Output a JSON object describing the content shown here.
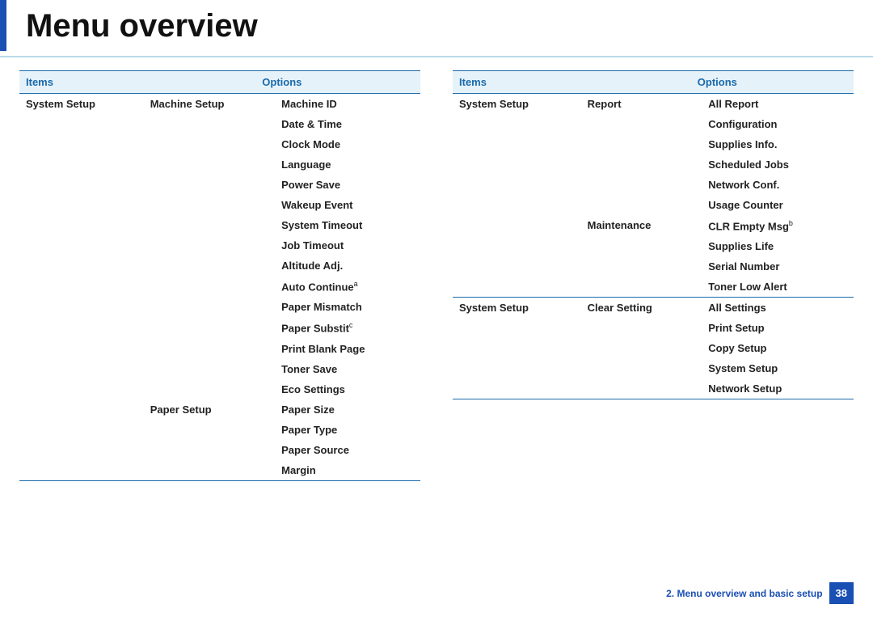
{
  "title": "Menu overview",
  "headers": {
    "items": "Items",
    "options": "Options"
  },
  "left": [
    {
      "item": "System Setup",
      "sub": "Machine Setup",
      "opts": [
        "Machine ID",
        "Date & Time",
        "Clock Mode",
        "Language",
        "Power Save",
        "Wakeup Event",
        "System Timeout",
        "Job Timeout",
        "Altitude Adj.",
        "Auto Continue",
        "Paper Mismatch",
        "Paper Substit",
        " Print Blank Page",
        "Toner Save",
        "Eco Settings"
      ]
    },
    {
      "item": "",
      "sub": "Paper Setup",
      "opts": [
        "Paper Size",
        "Paper Type",
        "Paper Source",
        "Margin"
      ]
    }
  ],
  "left_footnotes": {
    "Auto Continue": "a",
    "Paper Substit": "c"
  },
  "right": [
    {
      "item": "System Setup",
      "sub": "Report",
      "opts": [
        "All Report",
        "Configuration",
        "Supplies Info.",
        "Scheduled Jobs",
        "Network Conf.",
        "Usage Counter"
      ]
    },
    {
      "item": "",
      "sub": "Maintenance",
      "opts": [
        "CLR Empty Msg",
        "Supplies Life",
        "Serial Number",
        "Toner Low Alert"
      ]
    },
    {
      "item": "System Setup",
      "sub": "Clear Setting",
      "opts": [
        "All Settings",
        "Print Setup",
        "Copy Setup",
        "System Setup",
        "Network Setup"
      ]
    }
  ],
  "right_footnotes": {
    "CLR Empty Msg": "b"
  },
  "footer": {
    "chapter": "2.  Menu overview and basic setup",
    "page": "38"
  }
}
